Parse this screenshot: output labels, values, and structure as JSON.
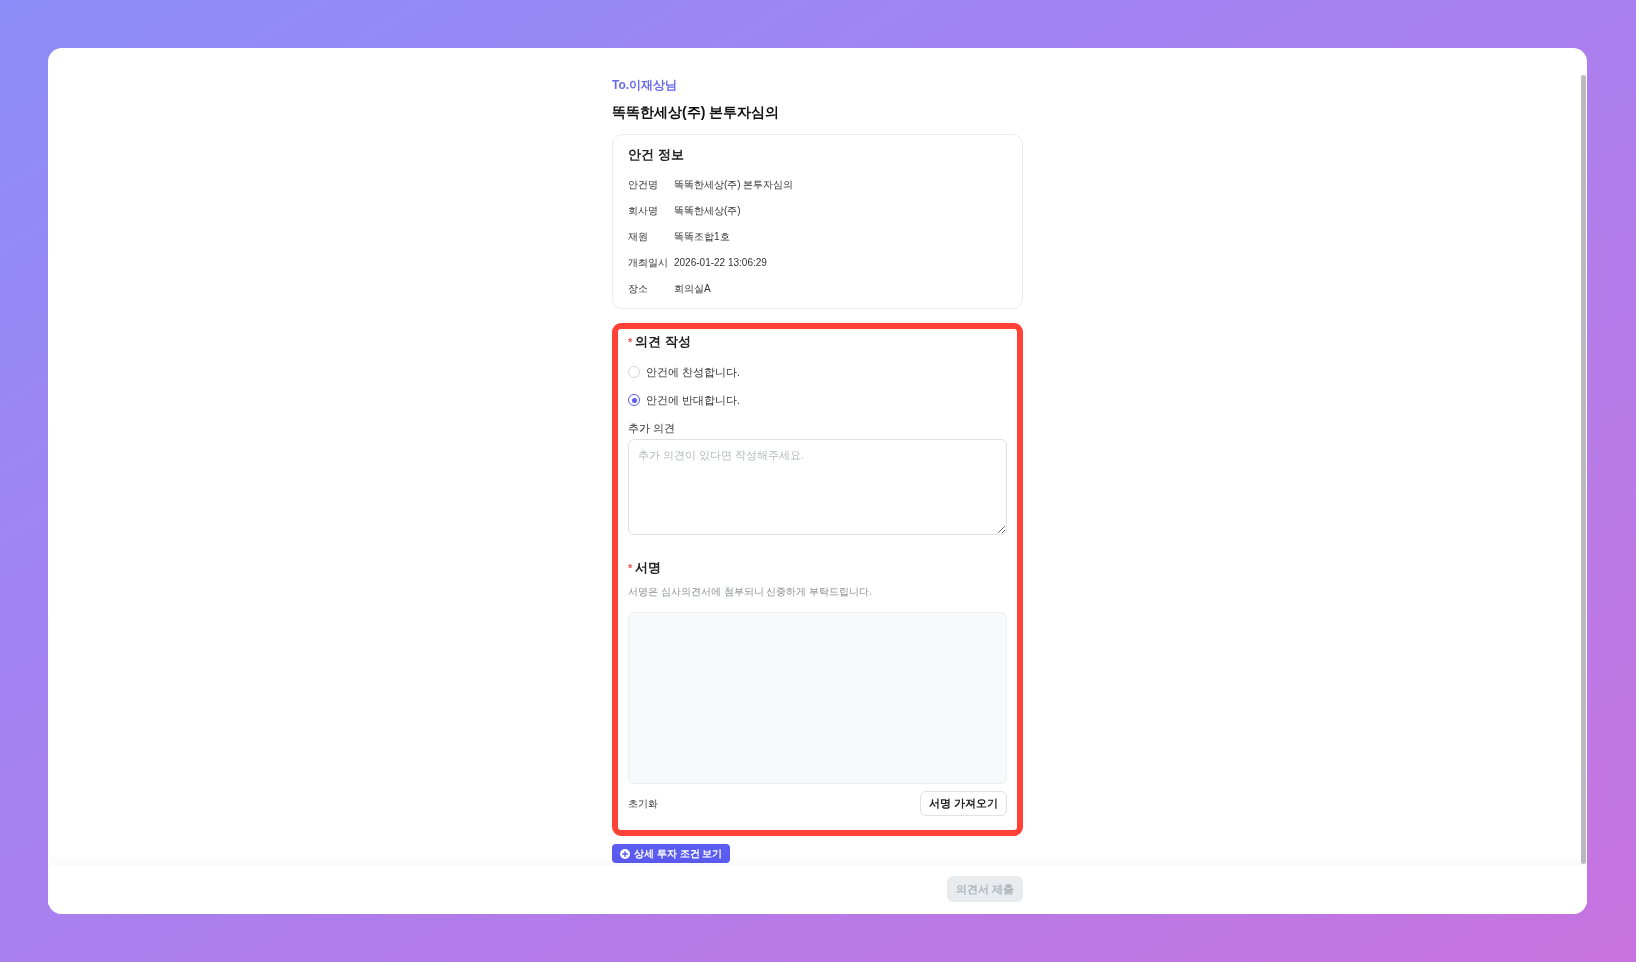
{
  "recipient": "To.이재상님",
  "title": "똑똑한세상(주) 본투자심의",
  "info_card": {
    "title": "안건 정보",
    "rows": [
      {
        "label": "안건명",
        "value": "똑똑한세상(주) 본투자심의"
      },
      {
        "label": "회사명",
        "value": "똑똑한세상(주)"
      },
      {
        "label": "재원",
        "value": "똑똑조합1호"
      },
      {
        "label": "개최일시",
        "value": "2026-01-22 13:06:29"
      },
      {
        "label": "장소",
        "value": "회의실A"
      }
    ]
  },
  "opinion_form": {
    "highlighted": true,
    "opinion": {
      "required_mark": "*",
      "label": "의견 작성",
      "options": [
        {
          "label": "안건에 찬성합니다.",
          "selected": false
        },
        {
          "label": "안건에 반대합니다.",
          "selected": true
        }
      ]
    },
    "additional": {
      "label": "추가 의견",
      "placeholder": "추가 의견이 있다면 작성해주세요."
    },
    "signature": {
      "required_mark": "*",
      "label": "서명",
      "hint": "서명은 심사의견서에 첨부되니 신중하게 부탁드립니다.",
      "reset": "초기화",
      "load_button": "서명 가져오기"
    }
  },
  "details_button": "상세 투자 조건 보기",
  "submit_button": {
    "label": "의견서 제출",
    "disabled": true
  }
}
